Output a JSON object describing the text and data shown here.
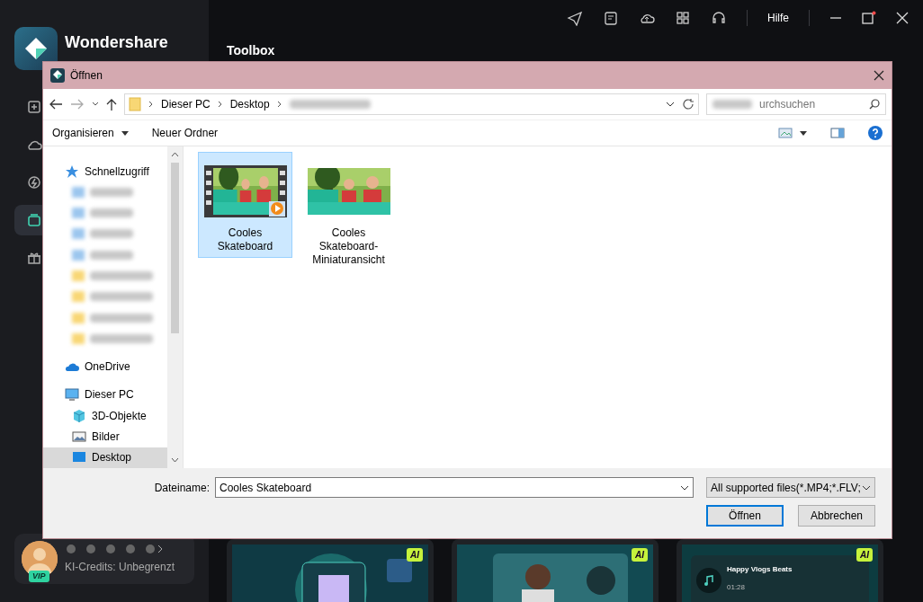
{
  "app": {
    "brand": "Wondershare",
    "heading": "Toolbox",
    "help": "Hilfe",
    "sidebar_items": [
      {
        "selected": false
      },
      {
        "selected": false
      },
      {
        "selected": false
      },
      {
        "selected": true
      },
      {
        "selected": false
      }
    ],
    "vip": "VIP",
    "credits": "KI-Credits: Unbegrenzt",
    "cards": [
      {
        "badge": "AI"
      },
      {
        "badge": "AI"
      },
      {
        "badge": "AI",
        "track_title": "Happy Vlogs Beats",
        "track_time": "01:28"
      }
    ]
  },
  "dialog": {
    "title": "Öffnen",
    "breadcrumb": [
      "Dieser PC",
      "Desktop"
    ],
    "search_placeholder": "urchsuchen",
    "toolbar": [
      "Organisieren",
      "Neuer Ordner"
    ],
    "nav": [
      {
        "kind": "quick",
        "label": "Schnellzugriff",
        "selected": false
      },
      {
        "kind": "blurred",
        "selected": false
      },
      {
        "kind": "blurred",
        "selected": false
      },
      {
        "kind": "blurred",
        "selected": false
      },
      {
        "kind": "blurred",
        "selected": false
      },
      {
        "kind": "blurred-folder",
        "selected": false
      },
      {
        "kind": "blurred-folder",
        "selected": false
      },
      {
        "kind": "blurred-folder",
        "selected": false
      },
      {
        "kind": "blurred-folder",
        "selected": false
      },
      {
        "kind": "cloud",
        "label": "OneDrive",
        "selected": false
      },
      {
        "kind": "pc",
        "label": "Dieser PC",
        "selected": false
      },
      {
        "kind": "cube",
        "label": "3D-Objekte",
        "selected": false
      },
      {
        "label": "Bilder",
        "selected": false
      },
      {
        "kind": "desktop",
        "label": "Desktop",
        "selected": true
      }
    ],
    "files": [
      {
        "kind": "video",
        "name": "Cooles Skateboard",
        "selected": true
      },
      {
        "name": "Cooles Skateboard-Miniaturansicht",
        "selected": false
      }
    ],
    "filename_label": "Dateiname:",
    "filename": "Cooles Skateboard",
    "filter": "All supported files(*.MP4;*.FLV;",
    "buttons": [
      "Öffnen",
      "Abbrechen"
    ]
  }
}
